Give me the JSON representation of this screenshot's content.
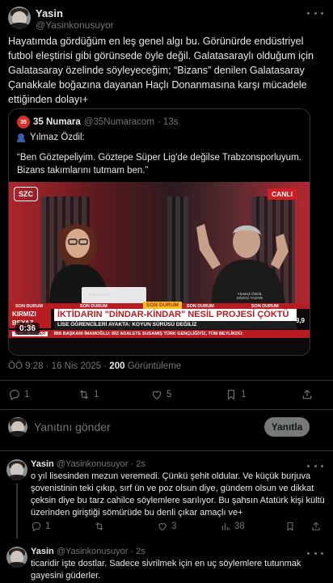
{
  "main_tweet": {
    "author_name": "Yasin",
    "author_handle": "@Yasinkonusuyor",
    "text": "Hayatımda gördüğüm en leş genel algı bu. Görünürde endüstriyel futbol eleştirisi gibi görünsede öyle değil. Galatasaraylı olduğum için Galatasaray özelinde söyleyeceğim; “Bizans” denilen Galatasaray Çanakkale boğazına dayanan Haçlı Donanmasına karşı mücadele ettiğinden dolayı+",
    "timestamp": "ÖÖ 9:28 · 16 Nis 2025 ·",
    "views_count": "200",
    "views_label": "Görüntüleme",
    "actions": {
      "replies": "1",
      "retweets": "1",
      "likes": "5",
      "bookmarks": "1"
    }
  },
  "quote": {
    "logo_text": "35",
    "source_name": "35 Numara",
    "source_handle": "@35Numaracom",
    "time": "· 13s",
    "speaker": "Yılmaz Özdil:",
    "quote_text": "“Ben Göztepeliyim. Göztepe Süper Lig'de değilse Trabzonsporluyum. Bizans takımlarını tutmam ben.”",
    "video": {
      "channel_logo": "SZC",
      "live_badge": "CANLI",
      "status_bar": [
        "SON DURUM",
        "SON DURUM",
        "SON DURUM",
        "SON DURUM"
      ],
      "status_logo": "SON DURUM",
      "side_label_1": "KIRMIZI",
      "side_label_2": "BEYAZ",
      "headline": "İKTİDARIN \"DİNDAR-KİNDAR\" NESİL PROJESİ ÇÖKTÜ MÜ?",
      "subheadline": "LİSE ÖĞRENCİLERİ AYAKTA: KOYUN SÜRÜSÜ DEĞİLİZ",
      "ticker_label": "SICAK HABER",
      "ticker_text": "İBB BAŞKANI İMAMOĞLU: BİZ ADALETE SUSAMIŞ TÜRK GENÇLİĞİYİZ, TÜM BEYLİKDÜ:",
      "name_tag_left": "İPEK ÖZBEY",
      "name_tag_right_1": "YILMAZ ÖZDİL",
      "name_tag_right_2": "SÖZCÜ YAZARI",
      "corner_count": "9,9",
      "duration": "0:36"
    }
  },
  "reply_box": {
    "placeholder": "Yanıtını gönder",
    "button_label": "Yanıtla"
  },
  "replies": [
    {
      "author_name": "Yasin",
      "author_handle": "@Yasinkonusuyor",
      "time": "· 2s",
      "text": "o yıl lisesinden mezun veremedi. Çünkü şehit oldular. Ve küçük burjuva şovenistinin teki çıkıp, sırf ün ve poz olsun diye, gündem olsun ve dikkat çeksin diye bu tarz cahilce söylemlere sarılıyor. Bu şahsın Atatürk kişi kültü üzerinden giriştiği sömürüde bu denli çıkar amaçlı ve+",
      "actions": {
        "replies": "1",
        "retweets": "",
        "likes": "3",
        "views": "38"
      }
    },
    {
      "author_name": "Yasin",
      "author_handle": "@Yasinkonusuyor",
      "time": "· 2s",
      "text": "ticaridir işte dostlar. Sadece sivrilmek için en uç söylemlere tutunmak gayesini güderler."
    }
  ],
  "icons": {
    "more": "more-dots-icon",
    "reply": "reply-icon",
    "retweet": "retweet-icon",
    "like": "heart-icon",
    "bookmark": "bookmark-icon",
    "views": "views-icon",
    "share": "share-icon",
    "speaker": "speaker-emoji-icon"
  },
  "colors": {
    "background": "#000000",
    "text": "#e7e9ea",
    "muted": "#71767b",
    "border": "#2f3336",
    "reply_button": "#787a7a"
  }
}
